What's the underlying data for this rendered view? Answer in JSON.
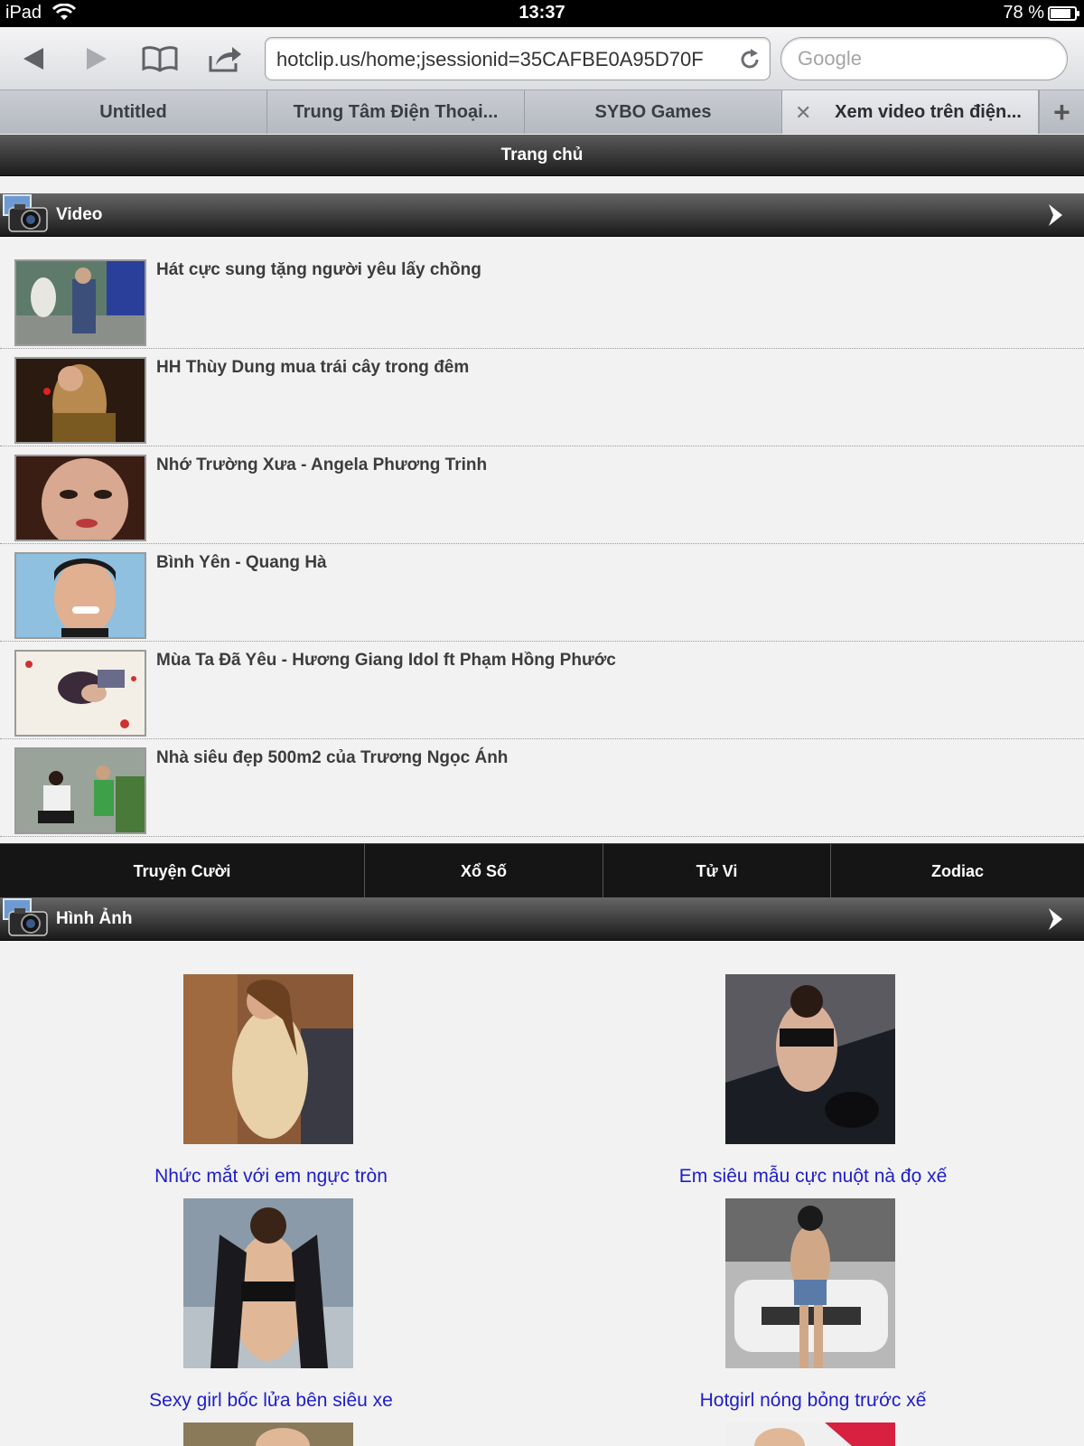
{
  "status_bar": {
    "device": "iPad",
    "time": "13:37",
    "battery": "78 %",
    "battery_level": 0.78
  },
  "browser": {
    "url": "hotclip.us/home;jsessionid=35CAFBE0A95D70F",
    "search_placeholder": "Google",
    "tabs": [
      {
        "label": "Untitled"
      },
      {
        "label": "Trung Tâm Điện Thoại..."
      },
      {
        "label": "SYBO Games"
      },
      {
        "label": "Xem video trên điện..."
      }
    ],
    "add_tab_label": "+",
    "close_tab_label": "✕"
  },
  "page": {
    "header_title": "Trang chủ",
    "video_section": {
      "title": "Video",
      "items": [
        {
          "title": "Hát cực sung tặng người yêu lấy chồng"
        },
        {
          "title": "HH Thùy Dung mua trái cây trong đêm"
        },
        {
          "title": "Nhớ Trường Xưa - Angela Phương Trinh"
        },
        {
          "title": "Bình Yên - Quang Hà"
        },
        {
          "title": "Mùa Ta Đã Yêu - Hương Giang Idol ft Phạm Hồng Phước"
        },
        {
          "title": "Nhà siêu đẹp 500m2 của Trương Ngọc Ánh"
        }
      ]
    },
    "categories": [
      {
        "label": "Truyện Cười"
      },
      {
        "label": "Xổ Số"
      },
      {
        "label": "Tử Vi"
      },
      {
        "label": "Zodiac"
      }
    ],
    "image_section": {
      "title": "Hình Ảnh",
      "items": [
        {
          "caption": "Nhức mắt với em ngực tròn"
        },
        {
          "caption": "Em siêu mẫu cực nuột nà đọ xế"
        },
        {
          "caption": "Sexy girl bốc lửa bên siêu xe"
        },
        {
          "caption": "Hotgirl nóng bỏng trước xế"
        }
      ]
    }
  },
  "colors": {
    "link": "#1d1dcc",
    "bar_dark": "#1a1a1a",
    "page_bg": "#f2f2f2"
  }
}
